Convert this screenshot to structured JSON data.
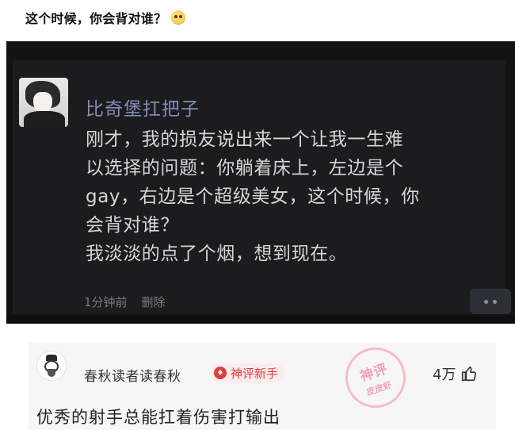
{
  "header": {
    "title": "这个时候，你会背对谁？"
  },
  "post": {
    "username": "比奇堡扛把子",
    "lines": [
      "刚才，我的损友说出来一个让我一生难",
      "以选择的问题：你躺着床上，左边是个",
      "gay，右边是个超级美女，这个时候，你",
      "会背对谁？",
      "我淡淡的点了个烟，想到现在。"
    ],
    "time": "1分钟前",
    "delete_label": "删除"
  },
  "comment": {
    "username": "春秋读者读春秋",
    "badge": "神评新手",
    "likes": "4万",
    "text": "优秀的射手总能扛着伤害打输出",
    "stamp": {
      "top": "神评",
      "bottom": "皮皮虾"
    }
  },
  "colors": {
    "dark_bg": "#131313",
    "card_bg": "#1c1c1e",
    "username_blue": "#7f8eb8",
    "badge_red": "#e63b3b"
  },
  "icons": {
    "title_emoji": "sweat-smile-emoji-icon",
    "more": "more-dots-icon",
    "like": "thumbs-up-icon",
    "badge": "flame-badge-icon"
  }
}
